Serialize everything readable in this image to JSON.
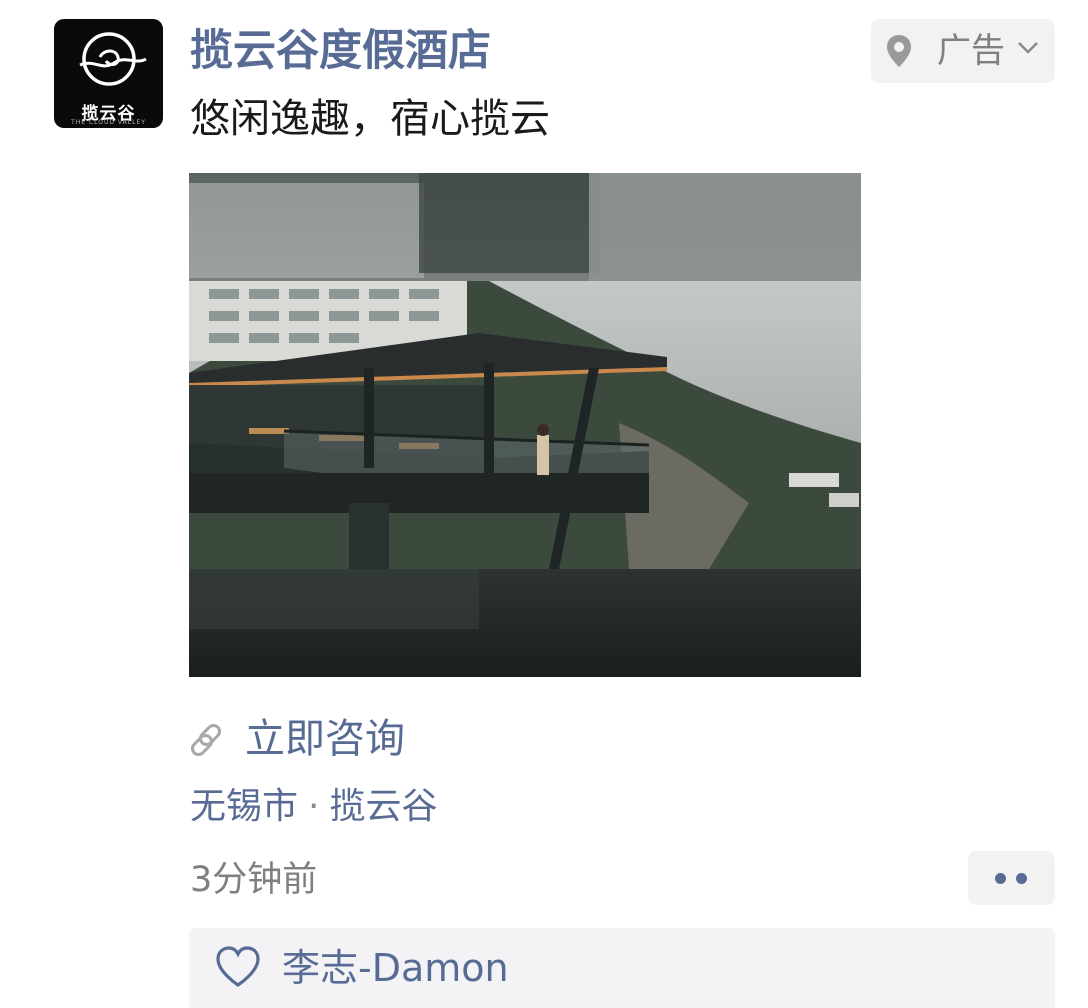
{
  "post": {
    "avatar": {
      "logo_text": "揽云谷",
      "logo_subtitle": "THE CLOUD VALLEY"
    },
    "advertiser_name": "揽云谷度假酒店",
    "slogan": "悠闲逸趣，宿心揽云",
    "ad_badge": {
      "label": "广告",
      "icons": [
        "location-pin-icon",
        "chevron-down-icon"
      ]
    },
    "media": {
      "type": "video-still",
      "subject": "glass-walled cantilevered restaurant pavilion on a mountain cliff beside a hotel building"
    },
    "cta": {
      "icon": "link-icon",
      "label": "立即咨询"
    },
    "location": {
      "city": "无锡市",
      "separator": "·",
      "place": "揽云谷"
    },
    "timestamp": "3分钟前",
    "more_button_icon": "two-dots-icon",
    "likes": {
      "icon": "heart-outline-icon",
      "users": [
        "李志-Damon"
      ]
    }
  },
  "colors": {
    "link_blue": "#576b95",
    "text_primary": "#1a1a1a",
    "text_secondary": "#7f7f7f",
    "badge_bg": "#f2f2f2",
    "likes_bg": "#f3f3f5"
  }
}
